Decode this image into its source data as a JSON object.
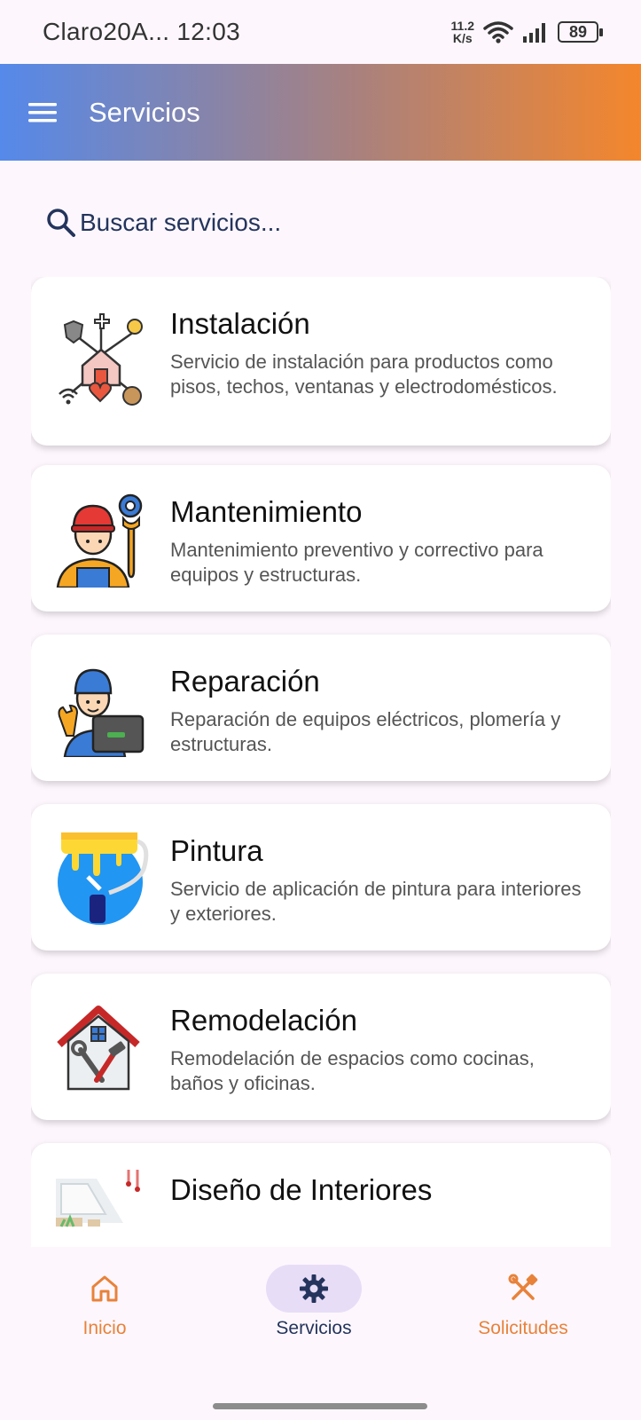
{
  "status_bar": {
    "carrier": "Claro20A...",
    "time": "12:03",
    "speed_value": "11.2",
    "speed_unit": "K/s",
    "battery": "89"
  },
  "app_bar": {
    "title": "Servicios",
    "menu_icon": "menu-icon"
  },
  "search": {
    "placeholder": "Buscar servicios...",
    "icon": "search-icon"
  },
  "services": [
    {
      "title": "Instalación",
      "description": "Servicio de instalación para productos como pisos, techos, ventanas y electrodomésticos.",
      "icon": "installation-icon"
    },
    {
      "title": "Mantenimiento",
      "description": "Mantenimiento preventivo y correctivo para equipos y estructuras.",
      "icon": "maintenance-worker-icon"
    },
    {
      "title": "Reparación",
      "description": "Reparación de equipos eléctricos, plomería y estructuras.",
      "icon": "repair-technician-icon"
    },
    {
      "title": "Pintura",
      "description": "Servicio de aplicación de pintura para interiores y exteriores.",
      "icon": "paint-roller-icon"
    },
    {
      "title": "Remodelación",
      "description": "Remodelación de espacios como cocinas, baños y oficinas.",
      "icon": "remodel-house-icon"
    },
    {
      "title": "Diseño de Interiores",
      "description": "",
      "icon": "interior-design-icon"
    }
  ],
  "bottom_nav": {
    "items": [
      {
        "label": "Inicio",
        "icon": "home-icon",
        "active": false
      },
      {
        "label": "Servicios",
        "icon": "gear-icon",
        "active": true
      },
      {
        "label": "Solicitudes",
        "icon": "tools-icon",
        "active": false
      }
    ]
  },
  "colors": {
    "gradient_start": "#5589ea",
    "gradient_end": "#f4862c",
    "accent_orange": "#e8823a",
    "accent_navy": "#24345c",
    "active_pill": "#e8ddf7"
  }
}
